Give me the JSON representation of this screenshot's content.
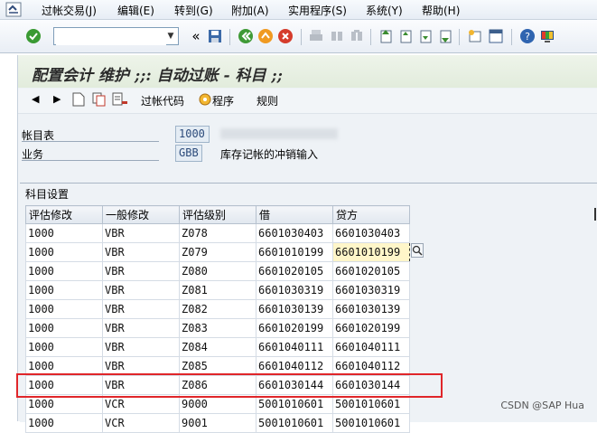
{
  "menu": {
    "items": [
      "过帐交易(J)",
      "编辑(E)",
      "转到(G)",
      "附加(A)",
      "实用程序(S)",
      "系统(Y)",
      "帮助(H)"
    ]
  },
  "toolbar": {
    "command_value": "",
    "double_arrow": "«"
  },
  "title": "配置会计 维护 ;;: 自动过账 - 科目 ;;",
  "app_toolbar": {
    "posting_code": "过帐代码",
    "program": "程序",
    "rules": "规则"
  },
  "fields": {
    "chart_label": "帐目表",
    "chart_value": "1000",
    "business_label": "业务",
    "business_value": "GBB",
    "business_desc": "库存记帐的冲销输入"
  },
  "group_title": "科目设置",
  "table": {
    "headers": [
      "评估修改",
      "一般修改",
      "评估级别",
      "借",
      "贷方"
    ],
    "rows": [
      [
        "1000",
        "VBR",
        "Z078",
        "6601030403",
        "6601030403"
      ],
      [
        "1000",
        "VBR",
        "Z079",
        "6601010199",
        "6601010199"
      ],
      [
        "1000",
        "VBR",
        "Z080",
        "6601020105",
        "6601020105"
      ],
      [
        "1000",
        "VBR",
        "Z081",
        "6601030319",
        "6601030319"
      ],
      [
        "1000",
        "VBR",
        "Z082",
        "6601030139",
        "6601030139"
      ],
      [
        "1000",
        "VBR",
        "Z083",
        "6601020199",
        "6601020199"
      ],
      [
        "1000",
        "VBR",
        "Z084",
        "6601040111",
        "6601040111"
      ],
      [
        "1000",
        "VBR",
        "Z085",
        "6601040112",
        "6601040112"
      ],
      [
        "1000",
        "VBR",
        "Z086",
        "6601030144",
        "6601030144"
      ],
      [
        "1000",
        "VCR",
        "9000",
        "5001010601",
        "5001010601"
      ],
      [
        "1000",
        "VCR",
        "9001",
        "5001010601",
        "5001010601"
      ]
    ]
  },
  "watermark": "CSDN @SAP Hua",
  "colors": {
    "highlight_border": "#e0262a",
    "focus_cell": "#fff6c9",
    "title_bg": "#e2ecdc"
  }
}
